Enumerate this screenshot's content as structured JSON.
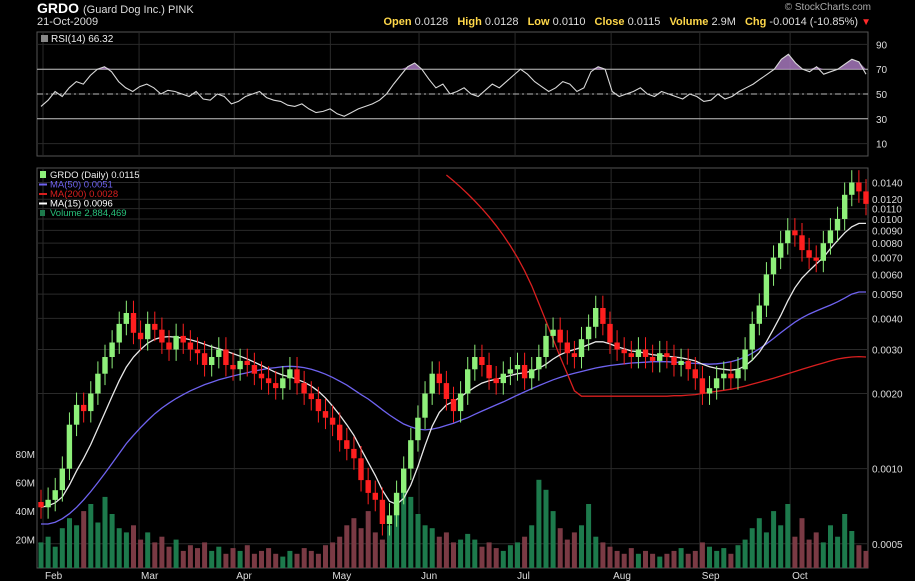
{
  "header": {
    "symbol": "GRDO",
    "company": "(Guard Dog Inc.) PINK",
    "date": "21-Oct-2009",
    "brand": "© StockCharts.com",
    "open_label": "Open",
    "open": "0.0128",
    "high_label": "High",
    "high": "0.0128",
    "low_label": "Low",
    "low": "0.0110",
    "close_label": "Close",
    "close": "0.0115",
    "volume_label": "Volume",
    "volume": "2.9M",
    "chg_label": "Chg",
    "chg": "-0.0014 (-10.85%)",
    "chg_icon": "down-triangle-icon"
  },
  "legend": {
    "price": "GRDO (Daily) 0.0115",
    "ma50": "MA(50) 0.0051",
    "ma200": "MA(200) 0.0028",
    "ma15": "MA(15) 0.0096",
    "volume": "Volume 2,884,469",
    "rsi": "RSI(14) 66.32"
  },
  "colors": {
    "background": "#000000",
    "grid": "#2a2a2a",
    "up_candle": "#8ef07a",
    "down_candle": "#ff1f1f",
    "ma50": "#6f63f0",
    "ma200": "#d81f1f",
    "ma15": "#e8e8e8",
    "volume_up": "#1d7a4c",
    "volume_down": "#7a3a44",
    "rsi_line": "#d8d8d8",
    "rsi_fill": "#b080c8"
  },
  "chart_data": [
    {
      "type": "line",
      "title": "RSI(14) 66.32",
      "ylim": [
        0,
        100
      ],
      "y_ticks": [
        "90",
        "70",
        "50",
        "30",
        "10"
      ],
      "reference_lines": [
        70,
        50,
        30
      ],
      "x_labels": [
        "Feb",
        "Mar",
        "Apr",
        "May",
        "Jun",
        "Jul",
        "Aug",
        "Sep",
        "Oct"
      ],
      "series": [
        {
          "name": "RSI(14)",
          "values": [
            40,
            45,
            52,
            48,
            55,
            60,
            58,
            65,
            70,
            72,
            68,
            60,
            55,
            52,
            56,
            58,
            55,
            50,
            53,
            52,
            50,
            48,
            52,
            46,
            45,
            50,
            48,
            42,
            44,
            48,
            50,
            52,
            47,
            45,
            44,
            41,
            40,
            42,
            38,
            35,
            36,
            38,
            34,
            32,
            35,
            38,
            40,
            42,
            45,
            50,
            58,
            65,
            72,
            75,
            70,
            62,
            55,
            58,
            50,
            52,
            55,
            50,
            48,
            53,
            58,
            55,
            60,
            65,
            70,
            66,
            60,
            56,
            52,
            55,
            60,
            58,
            52,
            55,
            68,
            72,
            70,
            52,
            48,
            50,
            52,
            55,
            50,
            48,
            52,
            50,
            48,
            46,
            50,
            48,
            44,
            45,
            50,
            46,
            48,
            52,
            55,
            58,
            62,
            66,
            70,
            78,
            82,
            75,
            70,
            68,
            72,
            66,
            68,
            70,
            74,
            78,
            76,
            66
          ]
        }
      ]
    },
    {
      "type": "candlestick",
      "title": "GRDO (Daily) 0.0115",
      "y_scale": "log",
      "ylim": [
        0.0004,
        0.016
      ],
      "y_ticks": [
        "0.0140",
        "0.0120",
        "0.0110",
        "0.0100",
        "0.0090",
        "0.0080",
        "0.0070",
        "0.0060",
        "0.0050",
        "0.0040",
        "0.0030",
        "0.0020",
        "0.0010",
        "0.0005"
      ],
      "x_labels": [
        "Feb",
        "Mar",
        "Apr",
        "May",
        "Jun",
        "Jul",
        "Aug",
        "Sep",
        "Oct"
      ],
      "close": [
        0.0007,
        0.00075,
        0.00082,
        0.001,
        0.0015,
        0.0018,
        0.0017,
        0.002,
        0.0024,
        0.0028,
        0.0032,
        0.0038,
        0.0042,
        0.0035,
        0.0033,
        0.0038,
        0.0036,
        0.0032,
        0.003,
        0.0034,
        0.0032,
        0.003,
        0.0029,
        0.0026,
        0.0028,
        0.003,
        0.0026,
        0.0025,
        0.0027,
        0.0026,
        0.0024,
        0.0023,
        0.0022,
        0.0021,
        0.0023,
        0.0025,
        0.0022,
        0.002,
        0.0019,
        0.0017,
        0.0016,
        0.0015,
        0.0013,
        0.0012,
        0.0011,
        0.0009,
        0.0008,
        0.00075,
        0.0006,
        0.00065,
        0.0008,
        0.001,
        0.0013,
        0.0016,
        0.002,
        0.0024,
        0.0022,
        0.0019,
        0.0017,
        0.002,
        0.0025,
        0.0028,
        0.0026,
        0.0023,
        0.0022,
        0.0024,
        0.0025,
        0.0026,
        0.0023,
        0.0025,
        0.0028,
        0.0034,
        0.0036,
        0.0032,
        0.0029,
        0.0028,
        0.0033,
        0.0037,
        0.0044,
        0.0038,
        0.0032,
        0.003,
        0.0029,
        0.0028,
        0.003,
        0.0028,
        0.0027,
        0.0029,
        0.0028,
        0.0026,
        0.0027,
        0.0025,
        0.0023,
        0.002,
        0.0021,
        0.0023,
        0.0024,
        0.0023,
        0.0025,
        0.003,
        0.0038,
        0.0045,
        0.006,
        0.007,
        0.008,
        0.009,
        0.0086,
        0.0075,
        0.007,
        0.0068,
        0.008,
        0.009,
        0.01,
        0.0125,
        0.014,
        0.0129,
        0.0115
      ],
      "series": [
        {
          "name": "MA(50)",
          "values": [
            0.0006,
            0.0006,
            0.00061,
            0.00063,
            0.00066,
            0.0007,
            0.00075,
            0.00081,
            0.00088,
            0.00096,
            0.00105,
            0.00115,
            0.00126,
            0.00136,
            0.00146,
            0.00156,
            0.00166,
            0.00175,
            0.00183,
            0.00191,
            0.00198,
            0.00205,
            0.00211,
            0.00217,
            0.00222,
            0.00227,
            0.00231,
            0.00235,
            0.00239,
            0.00242,
            0.00246,
            0.00249,
            0.00252,
            0.00254,
            0.00256,
            0.00257,
            0.00256,
            0.00254,
            0.0025,
            0.00245,
            0.00239,
            0.00232,
            0.00224,
            0.00216,
            0.00207,
            0.00198,
            0.0019,
            0.00181,
            0.00172,
            0.00164,
            0.00157,
            0.00151,
            0.00147,
            0.00144,
            0.00143,
            0.00144,
            0.00146,
            0.00149,
            0.00152,
            0.00156,
            0.0016,
            0.00165,
            0.0017,
            0.00175,
            0.0018,
            0.00185,
            0.00191,
            0.00197,
            0.00203,
            0.00209,
            0.00215,
            0.00221,
            0.00227,
            0.00232,
            0.00237,
            0.00241,
            0.00245,
            0.00249,
            0.00253,
            0.00256,
            0.00259,
            0.00261,
            0.00263,
            0.00265,
            0.00266,
            0.00267,
            0.00268,
            0.00268,
            0.00268,
            0.00267,
            0.00266,
            0.00265,
            0.00264,
            0.00263,
            0.00262,
            0.00263,
            0.00265,
            0.00268,
            0.00273,
            0.0028,
            0.0029,
            0.00302,
            0.00316,
            0.00332,
            0.0035,
            0.00368,
            0.00386,
            0.00402,
            0.00416,
            0.00428,
            0.0044,
            0.00452,
            0.00466,
            0.00482,
            0.005,
            0.0051,
            0.0051
          ]
        },
        {
          "name": "MA(200)",
          "values": [
            null,
            null,
            null,
            null,
            null,
            null,
            null,
            null,
            null,
            null,
            null,
            null,
            null,
            null,
            null,
            null,
            null,
            null,
            null,
            null,
            null,
            null,
            null,
            null,
            null,
            null,
            null,
            null,
            null,
            null,
            null,
            null,
            null,
            null,
            null,
            null,
            null,
            null,
            null,
            null,
            null,
            null,
            null,
            null,
            null,
            null,
            null,
            null,
            null,
            null,
            null,
            null,
            null,
            null,
            null,
            null,
            null,
            0.015,
            0.0142,
            0.0134,
            0.0126,
            0.0118,
            0.011,
            0.0102,
            0.0094,
            0.0086,
            0.0078,
            0.007,
            0.0062,
            0.0054,
            0.0046,
            0.0039,
            0.0033,
            0.0028,
            0.0024,
            0.00205,
            0.00195,
            0.00195,
            0.00195,
            0.00195,
            0.00195,
            0.00195,
            0.00195,
            0.00195,
            0.00195,
            0.00195,
            0.00195,
            0.00195,
            0.00195,
            0.00196,
            0.00196,
            0.00197,
            0.00198,
            0.002,
            0.00202,
            0.00204,
            0.00206,
            0.00208,
            0.00211,
            0.00214,
            0.00218,
            0.00222,
            0.00226,
            0.0023,
            0.00235,
            0.0024,
            0.00245,
            0.0025,
            0.00255,
            0.0026,
            0.00265,
            0.0027,
            0.00275,
            0.00278,
            0.0028,
            0.00281,
            0.0028
          ]
        },
        {
          "name": "MA(15)",
          "values": [
            0.0007,
            0.00071,
            0.00073,
            0.00077,
            0.00086,
            0.00098,
            0.0011,
            0.00125,
            0.00145,
            0.00168,
            0.00195,
            0.00225,
            0.00255,
            0.0028,
            0.003,
            0.00318,
            0.0033,
            0.00336,
            0.00338,
            0.00336,
            0.00333,
            0.00328,
            0.00322,
            0.00315,
            0.00308,
            0.00302,
            0.00296,
            0.00289,
            0.00282,
            0.00275,
            0.00267,
            0.00259,
            0.00251,
            0.00243,
            0.00237,
            0.00233,
            0.00228,
            0.00222,
            0.00214,
            0.00204,
            0.00192,
            0.00178,
            0.00164,
            0.0015,
            0.00136,
            0.0012,
            0.00106,
            0.00094,
            0.00082,
            0.00074,
            0.00072,
            0.00076,
            0.00086,
            0.00102,
            0.00124,
            0.00148,
            0.00168,
            0.0018,
            0.00186,
            0.00194,
            0.00203,
            0.00212,
            0.0022,
            0.00225,
            0.00228,
            0.00232,
            0.00236,
            0.0024,
            0.00242,
            0.00246,
            0.00252,
            0.00262,
            0.00275,
            0.00286,
            0.00294,
            0.003,
            0.00306,
            0.00314,
            0.00322,
            0.00322,
            0.00316,
            0.00308,
            0.00302,
            0.00296,
            0.00294,
            0.0029,
            0.00286,
            0.00284,
            0.00282,
            0.0028,
            0.00278,
            0.00274,
            0.0027,
            0.00262,
            0.00256,
            0.00252,
            0.0025,
            0.00248,
            0.0025,
            0.00258,
            0.00272,
            0.00292,
            0.00322,
            0.00362,
            0.0041,
            0.0047,
            0.0053,
            0.0058,
            0.0062,
            0.0066,
            0.007,
            0.0076,
            0.0082,
            0.0088,
            0.0093,
            0.0096,
            0.0096
          ]
        }
      ]
    },
    {
      "type": "bar",
      "title": "Volume 2,884,469",
      "y_ticks": [
        "80M",
        "60M",
        "40M",
        "20M"
      ],
      "ylim": [
        0,
        90
      ],
      "values_millions": [
        18,
        22,
        15,
        28,
        35,
        30,
        40,
        45,
        32,
        50,
        38,
        28,
        25,
        30,
        20,
        25,
        18,
        22,
        15,
        20,
        12,
        16,
        14,
        18,
        12,
        15,
        10,
        14,
        12,
        16,
        10,
        12,
        14,
        10,
        8,
        12,
        10,
        14,
        12,
        10,
        16,
        18,
        22,
        30,
        35,
        28,
        40,
        25,
        20,
        30,
        45,
        60,
        50,
        38,
        30,
        28,
        22,
        25,
        18,
        20,
        24,
        20,
        15,
        18,
        14,
        12,
        16,
        18,
        22,
        30,
        62,
        55,
        40,
        28,
        20,
        25,
        30,
        45,
        22,
        18,
        15,
        12,
        10,
        14,
        10,
        12,
        10,
        8,
        10,
        12,
        14,
        10,
        12,
        18,
        15,
        12,
        14,
        10,
        16,
        20,
        28,
        35,
        25,
        40,
        30,
        45,
        22,
        35,
        20,
        25,
        18,
        30,
        22,
        38,
        26,
        16,
        12
      ]
    }
  ]
}
